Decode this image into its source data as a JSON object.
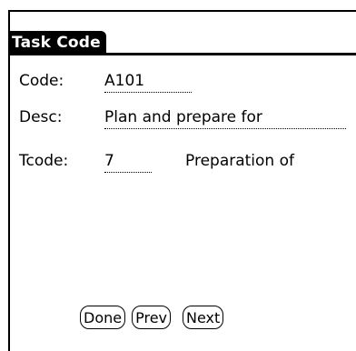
{
  "form": {
    "title": "Task Code",
    "code_label": "Code:",
    "code_value": "A101",
    "desc_label": "Desc:",
    "desc_value": "Plan and prepare for",
    "tcode_label": "Tcode:",
    "tcode_value": "7",
    "tcode_description": "Preparation of"
  },
  "buttons": {
    "done": "Done",
    "prev": "Prev",
    "next": "Next"
  }
}
